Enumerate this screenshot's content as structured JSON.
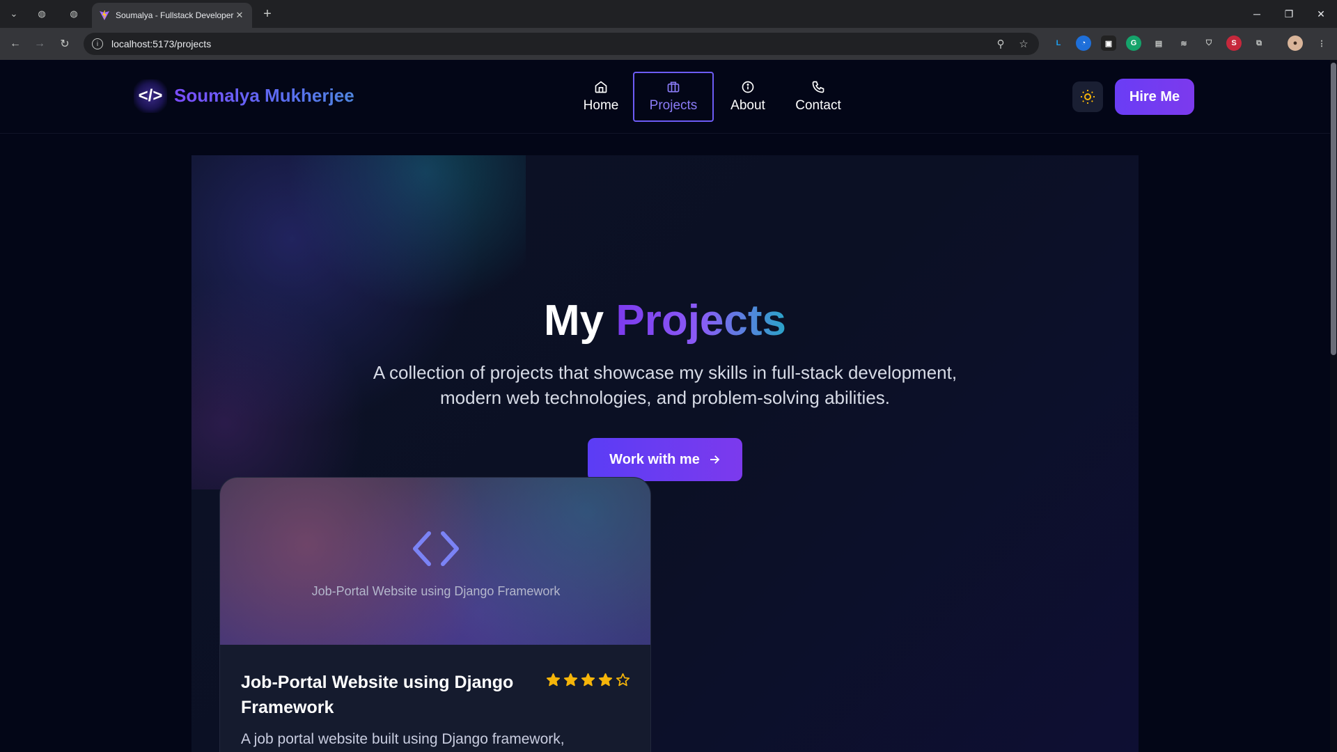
{
  "browser": {
    "tab_title": "Soumalya - Fullstack Developer",
    "url": "localhost:5173/projects"
  },
  "header": {
    "brand_icon": "</>",
    "brand_name": "Soumalya Mukherjee",
    "nav": [
      {
        "label": "Home",
        "icon": "home-icon"
      },
      {
        "label": "Projects",
        "icon": "briefcase-icon",
        "active": true
      },
      {
        "label": "About",
        "icon": "info-icon"
      },
      {
        "label": "Contact",
        "icon": "phone-icon"
      }
    ],
    "theme_icon": "sun-icon",
    "hire_label": "Hire Me"
  },
  "hero": {
    "title_plain": "My",
    "title_accent": "Projects",
    "subtitle_line1": "A collection of projects that showcase my skills in full-stack development,",
    "subtitle_line2": "modern web technologies, and problem-solving abilities.",
    "cta_label": "Work with me",
    "cta_icon": "arrow-right-icon"
  },
  "projects": [
    {
      "image_caption": "Job-Portal Website using Django Framework",
      "title_line1": "Job-Portal Website using Django",
      "title_line2": "Framework",
      "rating": 4,
      "rating_max": 5,
      "description": "A job portal website built using Django framework,"
    }
  ],
  "colors": {
    "accent": "#7c3aed",
    "background": "#030617",
    "star": "#f5b50a"
  }
}
